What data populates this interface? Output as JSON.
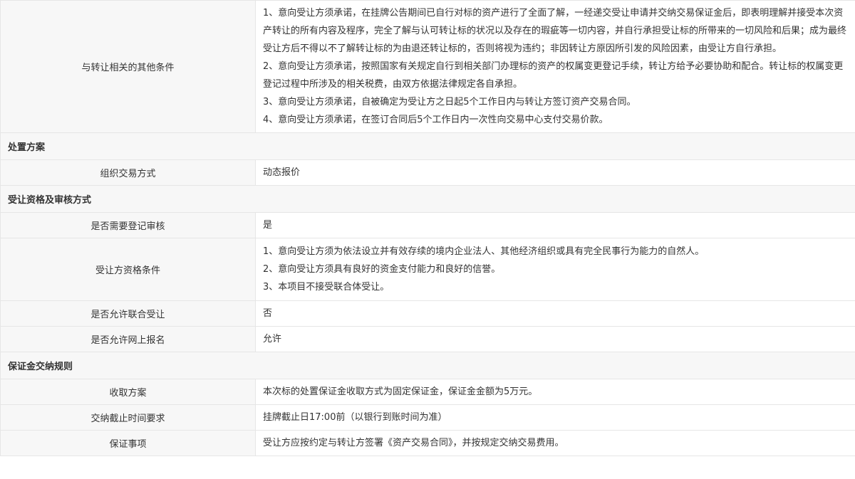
{
  "other_conditions": {
    "label": "与转让相关的其他条件",
    "items": [
      "1、意向受让方须承诺，在挂牌公告期间已自行对标的资产进行了全面了解，一经递交受让申请并交纳交易保证金后，即表明理解并接受本次资产转让的所有内容及程序，完全了解与认可转让标的状况以及存在的瑕疵等一切内容，并自行承担受让标的所带来的一切风险和后果；成为最终受让方后不得以不了解转让标的为由退还转让标的，否则将视为违约；非因转让方原因所引发的风险因素，由受让方自行承担。",
      "2、意向受让方须承诺，按照国家有关规定自行到相关部门办理标的资产的权属变更登记手续，转让方给予必要协助和配合。转让标的权属变更登记过程中所涉及的相关税费，由双方依据法律规定各自承担。",
      "3、意向受让方须承诺，自被确定为受让方之日起5个工作日内与转让方签订资产交易合同。",
      "4、意向受让方须承诺，在签订合同后5个工作日内一次性向交易中心支付交易价款。"
    ]
  },
  "disposal": {
    "section_title": "处置方案",
    "method_label": "组织交易方式",
    "method_value": "动态报价"
  },
  "qualification": {
    "section_title": "受让资格及审核方式",
    "registration_review_label": "是否需要登记审核",
    "registration_review_value": "是",
    "conditions_label": "受让方资格条件",
    "conditions": [
      "1、意向受让方须为依法设立并有效存续的境内企业法人、其他经济组织或具有完全民事行为能力的自然人。",
      "2、意向受让方须具有良好的资金支付能力和良好的信誉。",
      "3、本项目不接受联合体受让。"
    ],
    "joint_label": "是否允许联合受让",
    "joint_value": "否",
    "online_label": "是否允许网上报名",
    "online_value": "允许"
  },
  "deposit": {
    "section_title": "保证金交纳规则",
    "scheme_label": "收取方案",
    "scheme_value": "本次标的处置保证金收取方式为固定保证金，保证金金额为5万元。",
    "deadline_label": "交纳截止时间要求",
    "deadline_value": "挂牌截止日17:00前（以银行到账时间为准）",
    "matters_label": "保证事项",
    "matters_value": "受让方应按约定与转让方签署《资产交易合同》，并按规定交纳交易费用。"
  }
}
